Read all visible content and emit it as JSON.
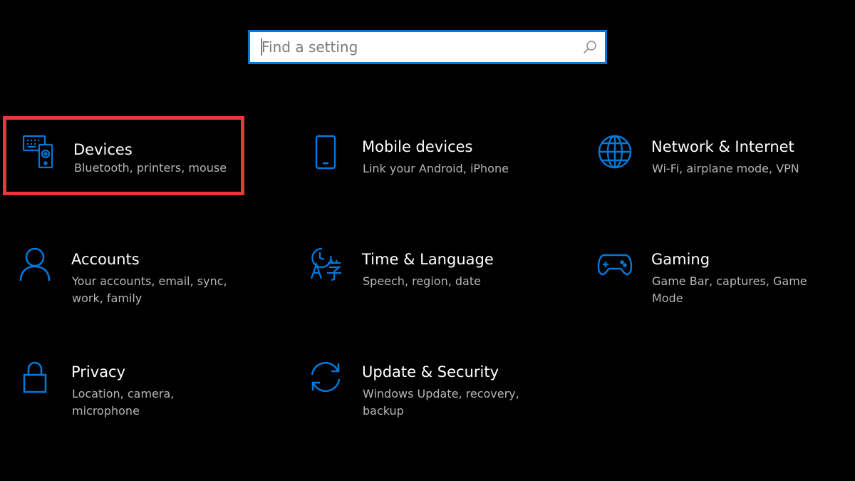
{
  "search": {
    "placeholder": "Find a setting",
    "value": ""
  },
  "accent_color": "#0078d7",
  "highlight_color": "#e8383d",
  "tiles": [
    {
      "title": "Devices",
      "description": "Bluetooth, printers, mouse",
      "icon": "devices-icon",
      "highlighted": true
    },
    {
      "title": "Mobile devices",
      "description": "Link your Android, iPhone",
      "icon": "phone-icon"
    },
    {
      "title": "Network & Internet",
      "description": "Wi-Fi, airplane mode, VPN",
      "icon": "globe-icon"
    },
    {
      "title": "Accounts",
      "description": "Your accounts, email, sync, work, family",
      "icon": "person-icon"
    },
    {
      "title": "Time & Language",
      "description": "Speech, region, date",
      "icon": "time-language-icon"
    },
    {
      "title": "Gaming",
      "description": "Game Bar, captures, Game Mode",
      "icon": "gamepad-icon"
    },
    {
      "title": "Privacy",
      "description": "Location, camera, microphone",
      "icon": "lock-icon"
    },
    {
      "title": "Update & Security",
      "description": "Windows Update, recovery, backup",
      "icon": "sync-icon"
    }
  ]
}
